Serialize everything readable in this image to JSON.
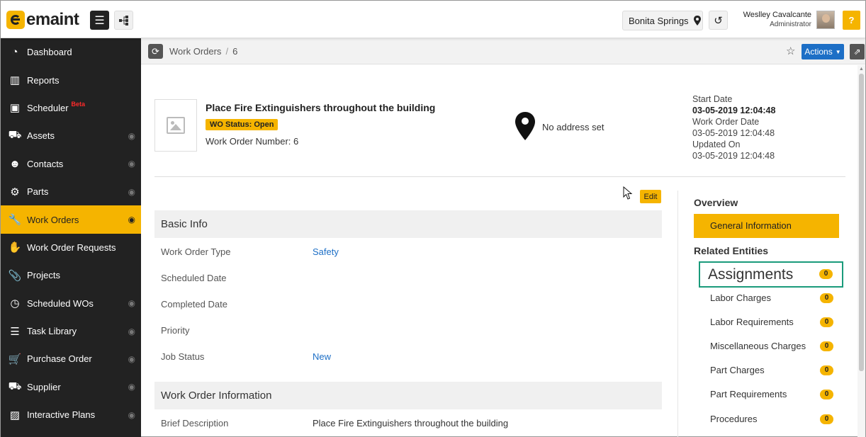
{
  "header": {
    "logo_text": "emaint",
    "location": "Bonita Springs",
    "user_name": "Weslley Cavalcante",
    "user_role": "Administrator",
    "help_label": "?"
  },
  "sidebar": {
    "items": [
      {
        "label": "Dashboard",
        "icon": "dashboard-icon"
      },
      {
        "label": "Reports",
        "icon": "bar-chart-icon"
      },
      {
        "label": "Scheduler",
        "icon": "calendar-check-icon",
        "badge": "Beta"
      },
      {
        "label": "Assets",
        "icon": "truck-icon"
      },
      {
        "label": "Contacts",
        "icon": "users-icon"
      },
      {
        "label": "Parts",
        "icon": "cogs-icon"
      },
      {
        "label": "Work Orders",
        "icon": "wrench-icon",
        "active": true
      },
      {
        "label": "Work Order Requests",
        "icon": "hand-icon"
      },
      {
        "label": "Projects",
        "icon": "paperclip-icon"
      },
      {
        "label": "Scheduled WOs",
        "icon": "clock-icon"
      },
      {
        "label": "Task Library",
        "icon": "list-icon"
      },
      {
        "label": "Purchase Order",
        "icon": "cart-icon"
      },
      {
        "label": "Supplier",
        "icon": "truck-icon"
      },
      {
        "label": "Interactive Plans",
        "icon": "image-icon"
      }
    ]
  },
  "breadcrumb": {
    "module": "Work Orders",
    "separator": "/",
    "record": "6",
    "actions_label": "Actions"
  },
  "summary": {
    "title": "Place Fire Extinguishers throughout the building",
    "status": "WO Status: Open",
    "number_label": "Work Order Number:",
    "number": "6",
    "address": "No address set",
    "start_date_label": "Start Date",
    "start_date": "03-05-2019 12:04:48",
    "wo_date_label": "Work Order Date",
    "wo_date": "03-05-2019 12:04:48",
    "updated_label": "Updated On",
    "updated": "03-05-2019 12:04:48"
  },
  "edit_label": "Edit",
  "basic_info": {
    "title": "Basic Info",
    "fields": [
      {
        "label": "Work Order Type",
        "value": "Safety"
      },
      {
        "label": "Scheduled Date",
        "value": ""
      },
      {
        "label": "Completed Date",
        "value": ""
      },
      {
        "label": "Priority",
        "value": ""
      },
      {
        "label": "Job Status",
        "value": "New"
      }
    ]
  },
  "wo_info": {
    "title": "Work Order Information",
    "fields": [
      {
        "label": "Brief Description",
        "value": "Place Fire Extinguishers throughout the building"
      }
    ]
  },
  "right_panel": {
    "overview_heading": "Overview",
    "overview_item": "General Information",
    "related_heading": "Related Entities",
    "highlighted": {
      "label": "Assignments",
      "count": "0"
    },
    "items": [
      {
        "label": "Labor Charges",
        "count": "0"
      },
      {
        "label": "Labor Requirements",
        "count": "0"
      },
      {
        "label": "Miscellaneous Charges",
        "count": "0"
      },
      {
        "label": "Part Charges",
        "count": "0"
      },
      {
        "label": "Part Requirements",
        "count": "0"
      },
      {
        "label": "Procedures",
        "count": "0"
      }
    ]
  },
  "colors": {
    "accent": "#f5b400",
    "sidebar_bg": "#222222",
    "link": "#1d6fc6",
    "highlight": "#1a9b7b"
  }
}
